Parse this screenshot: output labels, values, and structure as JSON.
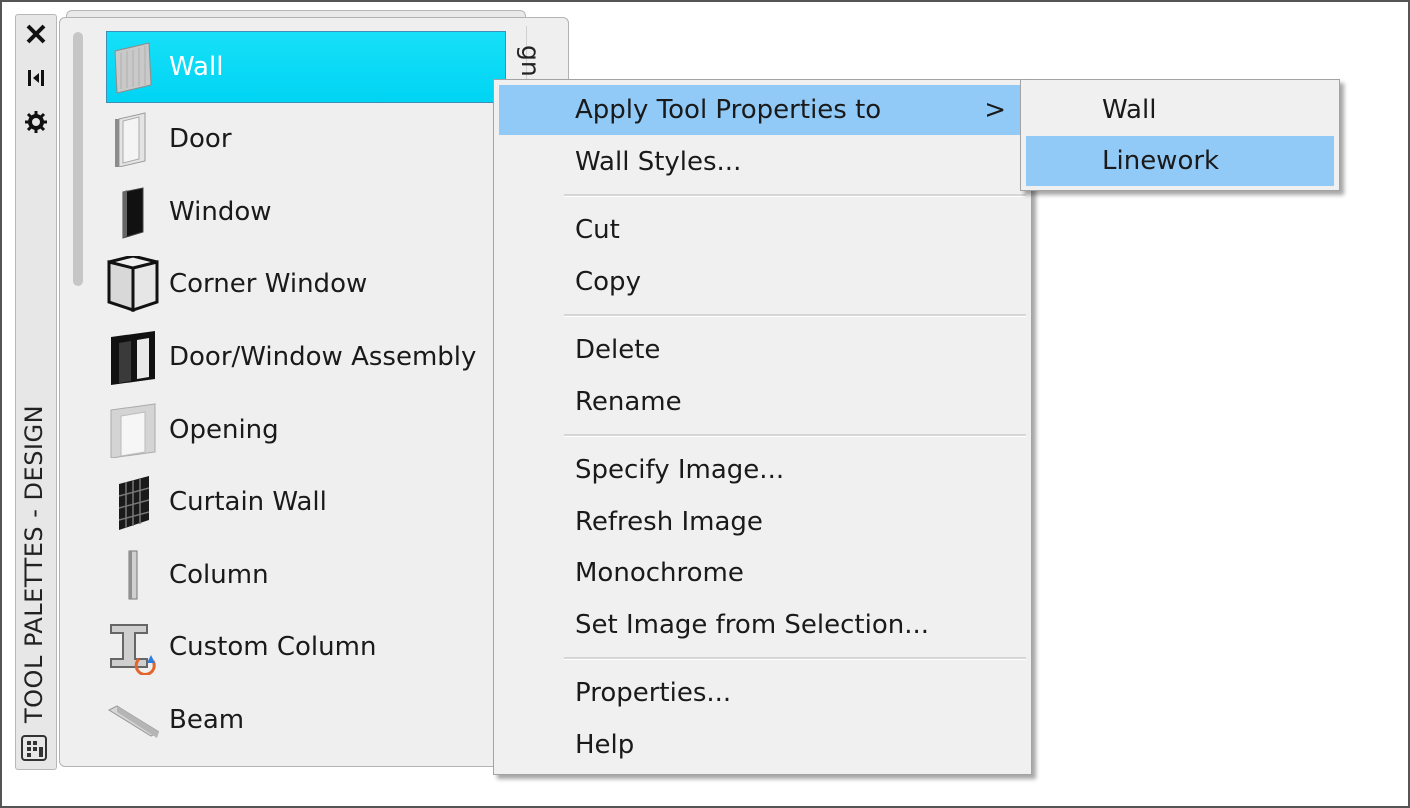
{
  "palette": {
    "vertical_title": "TOOL PALETTES - DESIGN",
    "tab_label": "gn",
    "titlebar_icons": [
      "close-icon",
      "auto-hide-icon",
      "properties-icon"
    ],
    "tools": [
      {
        "label": "Wall",
        "icon": "wall-icon",
        "selected": true
      },
      {
        "label": "Door",
        "icon": "door-icon"
      },
      {
        "label": "Window",
        "icon": "window-icon"
      },
      {
        "label": "Corner Window",
        "icon": "corner-window-icon"
      },
      {
        "label": "Door/Window Assembly",
        "icon": "door-window-assembly-icon"
      },
      {
        "label": "Opening",
        "icon": "opening-icon"
      },
      {
        "label": "Curtain Wall",
        "icon": "curtain-wall-icon"
      },
      {
        "label": "Column",
        "icon": "column-icon"
      },
      {
        "label": "Custom Column",
        "icon": "custom-column-icon"
      },
      {
        "label": "Beam",
        "icon": "beam-icon"
      }
    ]
  },
  "context_menu": {
    "items": [
      {
        "label": "Apply Tool Properties to",
        "has_submenu": true,
        "highlighted": true
      },
      {
        "label": "Wall Styles..."
      },
      {
        "label": "Cut"
      },
      {
        "label": "Copy"
      },
      {
        "label": "Delete"
      },
      {
        "label": "Rename"
      },
      {
        "label": "Specify Image..."
      },
      {
        "label": "Refresh Image"
      },
      {
        "label": "Monochrome"
      },
      {
        "label": "Set Image from Selection..."
      },
      {
        "label": "Properties..."
      },
      {
        "label": "Help"
      }
    ],
    "submenu_arrow": ">"
  },
  "submenu": {
    "items": [
      {
        "label": "Wall"
      },
      {
        "label": "Linework",
        "highlighted": true
      }
    ]
  },
  "colors": {
    "selected_tool": "#00d4f3",
    "menu_highlight": "#91c9f7",
    "menu_background": "#f0f0f0"
  }
}
